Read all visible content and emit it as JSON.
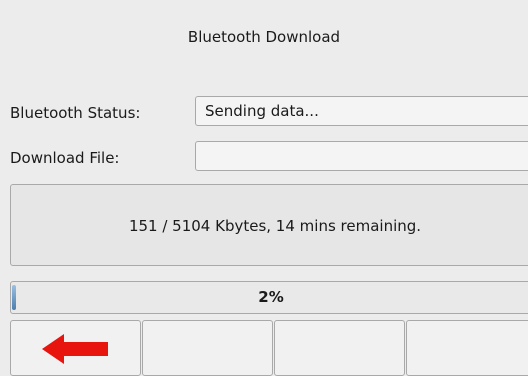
{
  "window": {
    "title": "Bluetooth Download"
  },
  "status": {
    "label": "Bluetooth Status:",
    "value": "Sending data..."
  },
  "file": {
    "label": "Download File:",
    "value": ""
  },
  "message": "151 / 5104 Kbytes, 14 mins remaining.",
  "progress": {
    "label": "2%",
    "fraction": 0.02,
    "fill_color": "#4a7eb0"
  },
  "buttons": [
    {
      "icon": "back-arrow-icon",
      "color": "#e8150f"
    },
    {
      "icon": ""
    },
    {
      "icon": ""
    },
    {
      "icon": ""
    }
  ]
}
